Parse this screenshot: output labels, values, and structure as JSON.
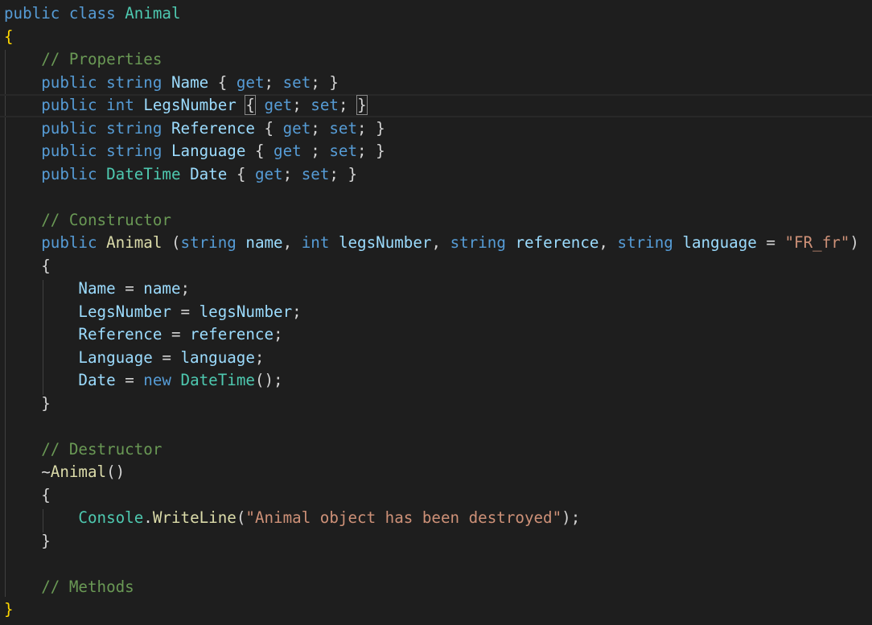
{
  "colors": {
    "background": "#1e1e1e",
    "keyword": "#569cd6",
    "type": "#4ec9b0",
    "identifier": "#9cdcfe",
    "method": "#dcdcaa",
    "string": "#ce9178",
    "comment": "#6a9955",
    "punctuation": "#d4d4d4",
    "bracket": "#ffd700"
  },
  "editor": {
    "current_line": 4,
    "lines": [
      [
        [
          "kw",
          "public"
        ],
        [
          "pn",
          " "
        ],
        [
          "kw",
          "class"
        ],
        [
          "pn",
          " "
        ],
        [
          "ty",
          "Animal"
        ]
      ],
      [
        [
          "br",
          "{"
        ]
      ],
      [
        [
          "pn",
          "    "
        ],
        [
          "cm",
          "// Properties"
        ]
      ],
      [
        [
          "pn",
          "    "
        ],
        [
          "kw",
          "public"
        ],
        [
          "pn",
          " "
        ],
        [
          "kw",
          "string"
        ],
        [
          "pn",
          " "
        ],
        [
          "id",
          "Name"
        ],
        [
          "pn",
          " { "
        ],
        [
          "kw",
          "get"
        ],
        [
          "pn",
          "; "
        ],
        [
          "kw",
          "set"
        ],
        [
          "pn",
          "; }"
        ]
      ],
      [
        [
          "pn",
          "    "
        ],
        [
          "kw",
          "public"
        ],
        [
          "pn",
          " "
        ],
        [
          "kw",
          "int"
        ],
        [
          "pn",
          " "
        ],
        [
          "id",
          "LegsNumber"
        ],
        [
          "pn",
          " "
        ],
        [
          "bm",
          "{"
        ],
        [
          "pn",
          " "
        ],
        [
          "kw",
          "get"
        ],
        [
          "pn",
          "; "
        ],
        [
          "kw",
          "set"
        ],
        [
          "pn",
          "; "
        ],
        [
          "bm",
          "}"
        ]
      ],
      [
        [
          "pn",
          "    "
        ],
        [
          "kw",
          "public"
        ],
        [
          "pn",
          " "
        ],
        [
          "kw",
          "string"
        ],
        [
          "pn",
          " "
        ],
        [
          "id",
          "Reference"
        ],
        [
          "pn",
          " { "
        ],
        [
          "kw",
          "get"
        ],
        [
          "pn",
          "; "
        ],
        [
          "kw",
          "set"
        ],
        [
          "pn",
          "; }"
        ]
      ],
      [
        [
          "pn",
          "    "
        ],
        [
          "kw",
          "public"
        ],
        [
          "pn",
          " "
        ],
        [
          "kw",
          "string"
        ],
        [
          "pn",
          " "
        ],
        [
          "id",
          "Language"
        ],
        [
          "pn",
          " { "
        ],
        [
          "kw",
          "get"
        ],
        [
          "pn",
          " ; "
        ],
        [
          "kw",
          "set"
        ],
        [
          "pn",
          "; }"
        ]
      ],
      [
        [
          "pn",
          "    "
        ],
        [
          "kw",
          "public"
        ],
        [
          "pn",
          " "
        ],
        [
          "ty",
          "DateTime"
        ],
        [
          "pn",
          " "
        ],
        [
          "id",
          "Date"
        ],
        [
          "pn",
          " { "
        ],
        [
          "kw",
          "get"
        ],
        [
          "pn",
          "; "
        ],
        [
          "kw",
          "set"
        ],
        [
          "pn",
          "; }"
        ]
      ],
      [],
      [
        [
          "pn",
          "    "
        ],
        [
          "cm",
          "// Constructor"
        ]
      ],
      [
        [
          "pn",
          "    "
        ],
        [
          "kw",
          "public"
        ],
        [
          "pn",
          " "
        ],
        [
          "fn",
          "Animal"
        ],
        [
          "pn",
          " ("
        ],
        [
          "kw",
          "string"
        ],
        [
          "pn",
          " "
        ],
        [
          "id",
          "name"
        ],
        [
          "pn",
          ", "
        ],
        [
          "kw",
          "int"
        ],
        [
          "pn",
          " "
        ],
        [
          "id",
          "legsNumber"
        ],
        [
          "pn",
          ", "
        ],
        [
          "kw",
          "string"
        ],
        [
          "pn",
          " "
        ],
        [
          "id",
          "reference"
        ],
        [
          "pn",
          ", "
        ],
        [
          "kw",
          "string"
        ],
        [
          "pn",
          " "
        ],
        [
          "id",
          "language"
        ],
        [
          "pn",
          " = "
        ],
        [
          "st",
          "\"FR_fr\""
        ],
        [
          "pn",
          ")"
        ]
      ],
      [
        [
          "pn",
          "    {"
        ]
      ],
      [
        [
          "pn",
          "        "
        ],
        [
          "id",
          "Name"
        ],
        [
          "pn",
          " = "
        ],
        [
          "id",
          "name"
        ],
        [
          "pn",
          ";"
        ]
      ],
      [
        [
          "pn",
          "        "
        ],
        [
          "id",
          "LegsNumber"
        ],
        [
          "pn",
          " = "
        ],
        [
          "id",
          "legsNumber"
        ],
        [
          "pn",
          ";"
        ]
      ],
      [
        [
          "pn",
          "        "
        ],
        [
          "id",
          "Reference"
        ],
        [
          "pn",
          " = "
        ],
        [
          "id",
          "reference"
        ],
        [
          "pn",
          ";"
        ]
      ],
      [
        [
          "pn",
          "        "
        ],
        [
          "id",
          "Language"
        ],
        [
          "pn",
          " = "
        ],
        [
          "id",
          "language"
        ],
        [
          "pn",
          ";"
        ]
      ],
      [
        [
          "pn",
          "        "
        ],
        [
          "id",
          "Date"
        ],
        [
          "pn",
          " = "
        ],
        [
          "kw",
          "new"
        ],
        [
          "pn",
          " "
        ],
        [
          "ty",
          "DateTime"
        ],
        [
          "pn",
          "();"
        ]
      ],
      [
        [
          "pn",
          "    }"
        ]
      ],
      [],
      [
        [
          "pn",
          "    "
        ],
        [
          "cm",
          "// Destructor"
        ]
      ],
      [
        [
          "pn",
          "    ~"
        ],
        [
          "fn",
          "Animal"
        ],
        [
          "pn",
          "()"
        ]
      ],
      [
        [
          "pn",
          "    {"
        ]
      ],
      [
        [
          "pn",
          "        "
        ],
        [
          "ty",
          "Console"
        ],
        [
          "pn",
          "."
        ],
        [
          "fn",
          "WriteLine"
        ],
        [
          "pn",
          "("
        ],
        [
          "st",
          "\"Animal object has been destroyed\""
        ],
        [
          "pn",
          ");"
        ]
      ],
      [
        [
          "pn",
          "    }"
        ]
      ],
      [],
      [
        [
          "pn",
          "    "
        ],
        [
          "cm",
          "// Methods"
        ]
      ],
      [
        [
          "br",
          "}"
        ]
      ]
    ]
  }
}
